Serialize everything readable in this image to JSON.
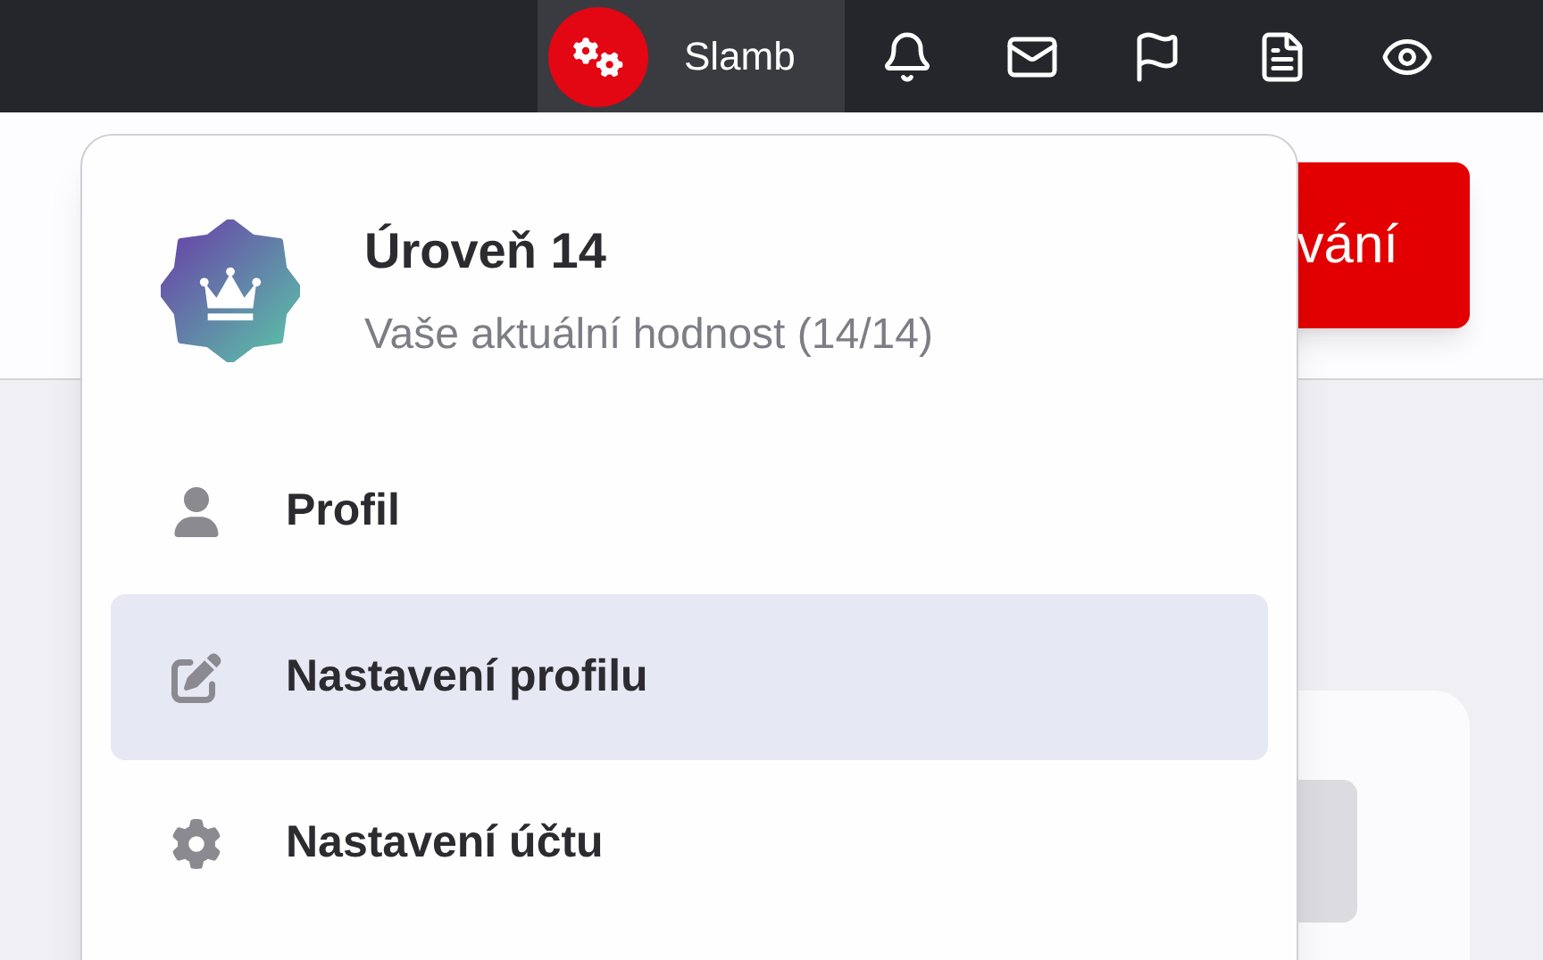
{
  "top_bar": {
    "user": {
      "name": "Slamb"
    },
    "icons": [
      {
        "kind": "bell"
      },
      {
        "kind": "mail"
      },
      {
        "kind": "flag"
      },
      {
        "kind": "document"
      },
      {
        "kind": "eye"
      }
    ]
  },
  "page": {
    "action_button": {
      "label": "vání"
    }
  },
  "dropdown": {
    "rank": {
      "title": "Úroveň 14",
      "subtitle": "Vaše aktuální hodnost (14/14)"
    },
    "items": [
      {
        "kind": "user",
        "label": "Profil",
        "selected": false
      },
      {
        "kind": "edit",
        "label": "Nastavení profilu",
        "selected": true
      },
      {
        "kind": "settings",
        "label": "Nastavení účtu",
        "selected": false
      }
    ]
  }
}
